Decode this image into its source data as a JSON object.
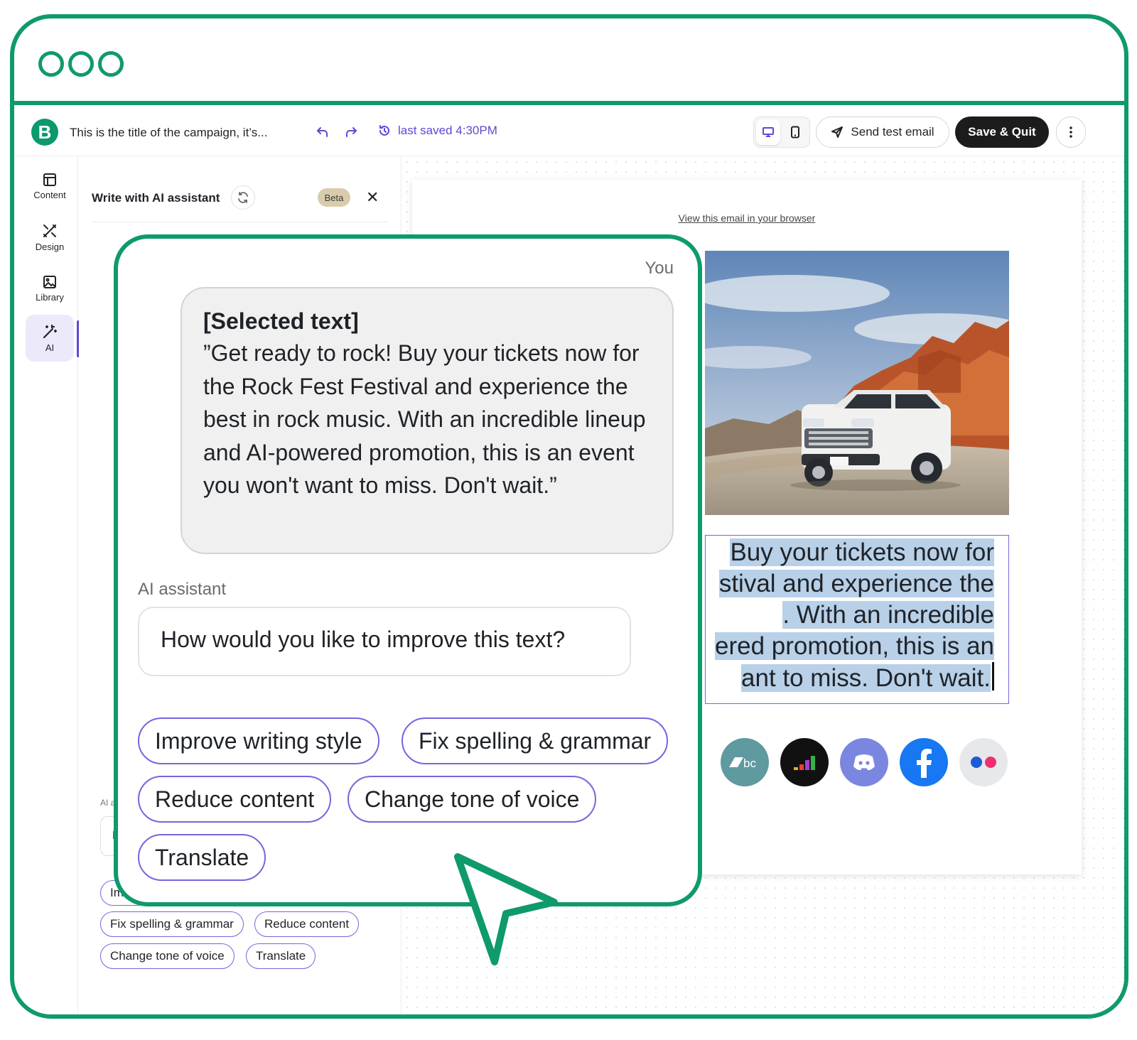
{
  "header": {
    "campaign_title": "This is the title of the campaign, it’s...",
    "last_saved": "last saved 4:30PM",
    "send_test_label": "Send test email",
    "save_quit_label": "Save & Quit"
  },
  "rail": {
    "items": [
      {
        "label": "Content",
        "icon": "layout-icon"
      },
      {
        "label": "Design",
        "icon": "design-tools-icon"
      },
      {
        "label": "Library",
        "icon": "image-icon"
      },
      {
        "label": "AI",
        "icon": "magic-wand-icon"
      }
    ]
  },
  "ai_panel": {
    "title": "Write with AI assistant",
    "badge": "Beta",
    "small_label": "AI as",
    "small_input_value": "H",
    "chips": [
      "Im",
      "Fix spelling & grammar",
      "Reduce content",
      "Change tone of voice",
      "Translate"
    ]
  },
  "email": {
    "view_in_browser": "View this email in your browser",
    "selected_lines": [
      "Buy your tickets now for",
      "stival and experience the",
      ". With an incredible",
      "ered promotion, this is an",
      "ant to miss. Don't wait."
    ],
    "social_icons": [
      "bandcamp-icon",
      "deezer-icon",
      "discord-icon",
      "facebook-icon",
      "flickr-icon"
    ]
  },
  "chat": {
    "you_label": "You",
    "selected_heading": "[Selected text]",
    "selected_text": "”Get ready to rock! Buy your tickets now for the Rock Fest Festival and experience the best in rock music. With an incredible lineup and AI-powered promotion, this is an event you won't want to miss. Don't wait.”",
    "assistant_label": "AI assistant",
    "assistant_question": "How would you like to improve this text?",
    "suggestions": [
      "Improve writing style",
      "Fix spelling & grammar",
      "Reduce content",
      "Change tone of voice",
      "Translate"
    ]
  },
  "colors": {
    "frame": "#0f9a6c",
    "accent": "#5b4ad6",
    "chip_border": "#7466dd",
    "highlight": "#b8d0e8"
  }
}
